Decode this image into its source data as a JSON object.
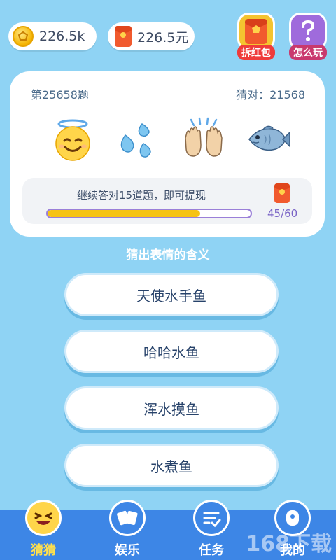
{
  "topbar": {
    "coins": "226.5k",
    "cash": "226.5元",
    "hongbao_label": "拆红包",
    "howto_label": "怎么玩"
  },
  "card": {
    "question_no": "第25658题",
    "correct_count": "猜对：21568",
    "emojis": [
      "smiling-halo-face",
      "sweat-droplets",
      "raising-hands",
      "fish"
    ],
    "progress_text": "继续答对15道题，即可提现",
    "progress": {
      "current": 45,
      "total": 60,
      "label": "45/60"
    }
  },
  "prompt": "猜出表情的含义",
  "answers": [
    "天使水手鱼",
    "哈哈水鱼",
    "浑水摸鱼",
    "水煮鱼"
  ],
  "nav": [
    {
      "label": "猜猜",
      "icon": "laughing-face-icon",
      "active": true
    },
    {
      "label": "娱乐",
      "icon": "cards-icon",
      "active": false
    },
    {
      "label": "任务",
      "icon": "checklist-icon",
      "active": false
    },
    {
      "label": "我的",
      "icon": "profile-icon",
      "active": false
    }
  ],
  "colors": {
    "background": "#8fd3f4",
    "nav": "#3d86e6",
    "progress_fill": "#f6c315",
    "active_nav": "#ffe04d"
  },
  "watermark": "168下载"
}
